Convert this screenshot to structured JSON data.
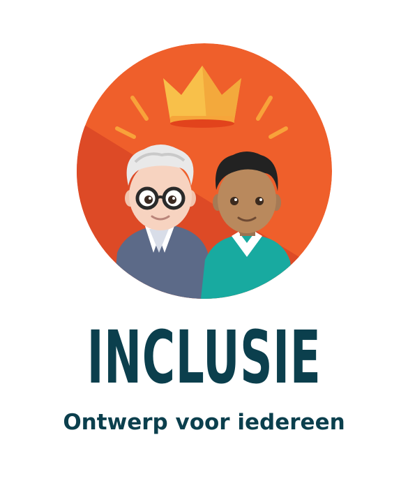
{
  "badge": {
    "title": "INCLUSIE",
    "subtitle": "Ontwerp voor iedereen"
  },
  "colors": {
    "circle": "#ef5f2b",
    "circle_shadow": "#dd4a26",
    "crown": "#f8c04a",
    "text": "#0b3f4d",
    "cardigan": "#5c6a88",
    "sweater": "#18aaa0"
  }
}
